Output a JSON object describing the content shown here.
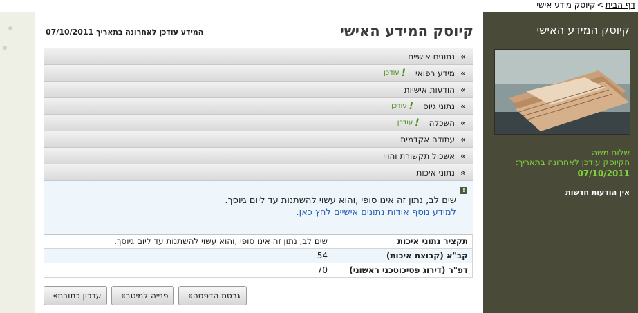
{
  "breadcrumb": {
    "home": "דף הבית",
    "separator": ">",
    "current": "קיוסק מידע אישי"
  },
  "sidebar": {
    "title": "קיוסק המידע האישי",
    "greeting": "שלום משה",
    "updated_text": "הקיוסק עודכן לאחרונה בתאריך:",
    "updated_date": "07/10/2011",
    "no_news": "אין הודעות חדשות"
  },
  "main": {
    "title": "קיוסק המידע האישי",
    "updated_label": "המידע עודכן לאחרונה בתאריך",
    "updated_date": "07/10/2011"
  },
  "accordion": [
    {
      "label": "נתונים אישיים",
      "chevron": "»",
      "badge": ""
    },
    {
      "label": "מידע רפואי",
      "chevron": "»",
      "badge": "עודכן"
    },
    {
      "label": "הודעות אישיות",
      "chevron": "»",
      "badge": ""
    },
    {
      "label": "נתוני גיוס",
      "chevron": "»",
      "badge": "עודכן"
    },
    {
      "label": "השכלה",
      "chevron": "»",
      "badge": "עודכן"
    },
    {
      "label": "עתודה אקדמית",
      "chevron": "»",
      "badge": ""
    },
    {
      "label": "אשכול תקשורת והווי",
      "chevron": "»",
      "badge": ""
    },
    {
      "label": "נתוני איכות",
      "chevron": "»",
      "badge": ""
    }
  ],
  "notice": {
    "icon": "!",
    "text": "שים לב, נתון זה אינו סופי ,והוא עשוי להשתנות עד ליום גיוסך.",
    "link": "למידע נוסף אודות נתונים אישיים לחץ כאן."
  },
  "quality_table": [
    {
      "label": "תקציר נתוני איכות",
      "value": "שים לב, נתון זה אינו סופי ,והוא עשוי להשתנות עד ליום גיוסך."
    },
    {
      "label": "קב\"א (קבוצת איכות)",
      "value": "54"
    },
    {
      "label": "דפ\"ר (דירוג פסיכוטכני ראשוני)",
      "value": "70"
    }
  ],
  "buttons": {
    "print": "גרסת הדפסה",
    "contact": "פנייה למיטב",
    "address": "עדכון כתובת",
    "arrow": "»"
  }
}
